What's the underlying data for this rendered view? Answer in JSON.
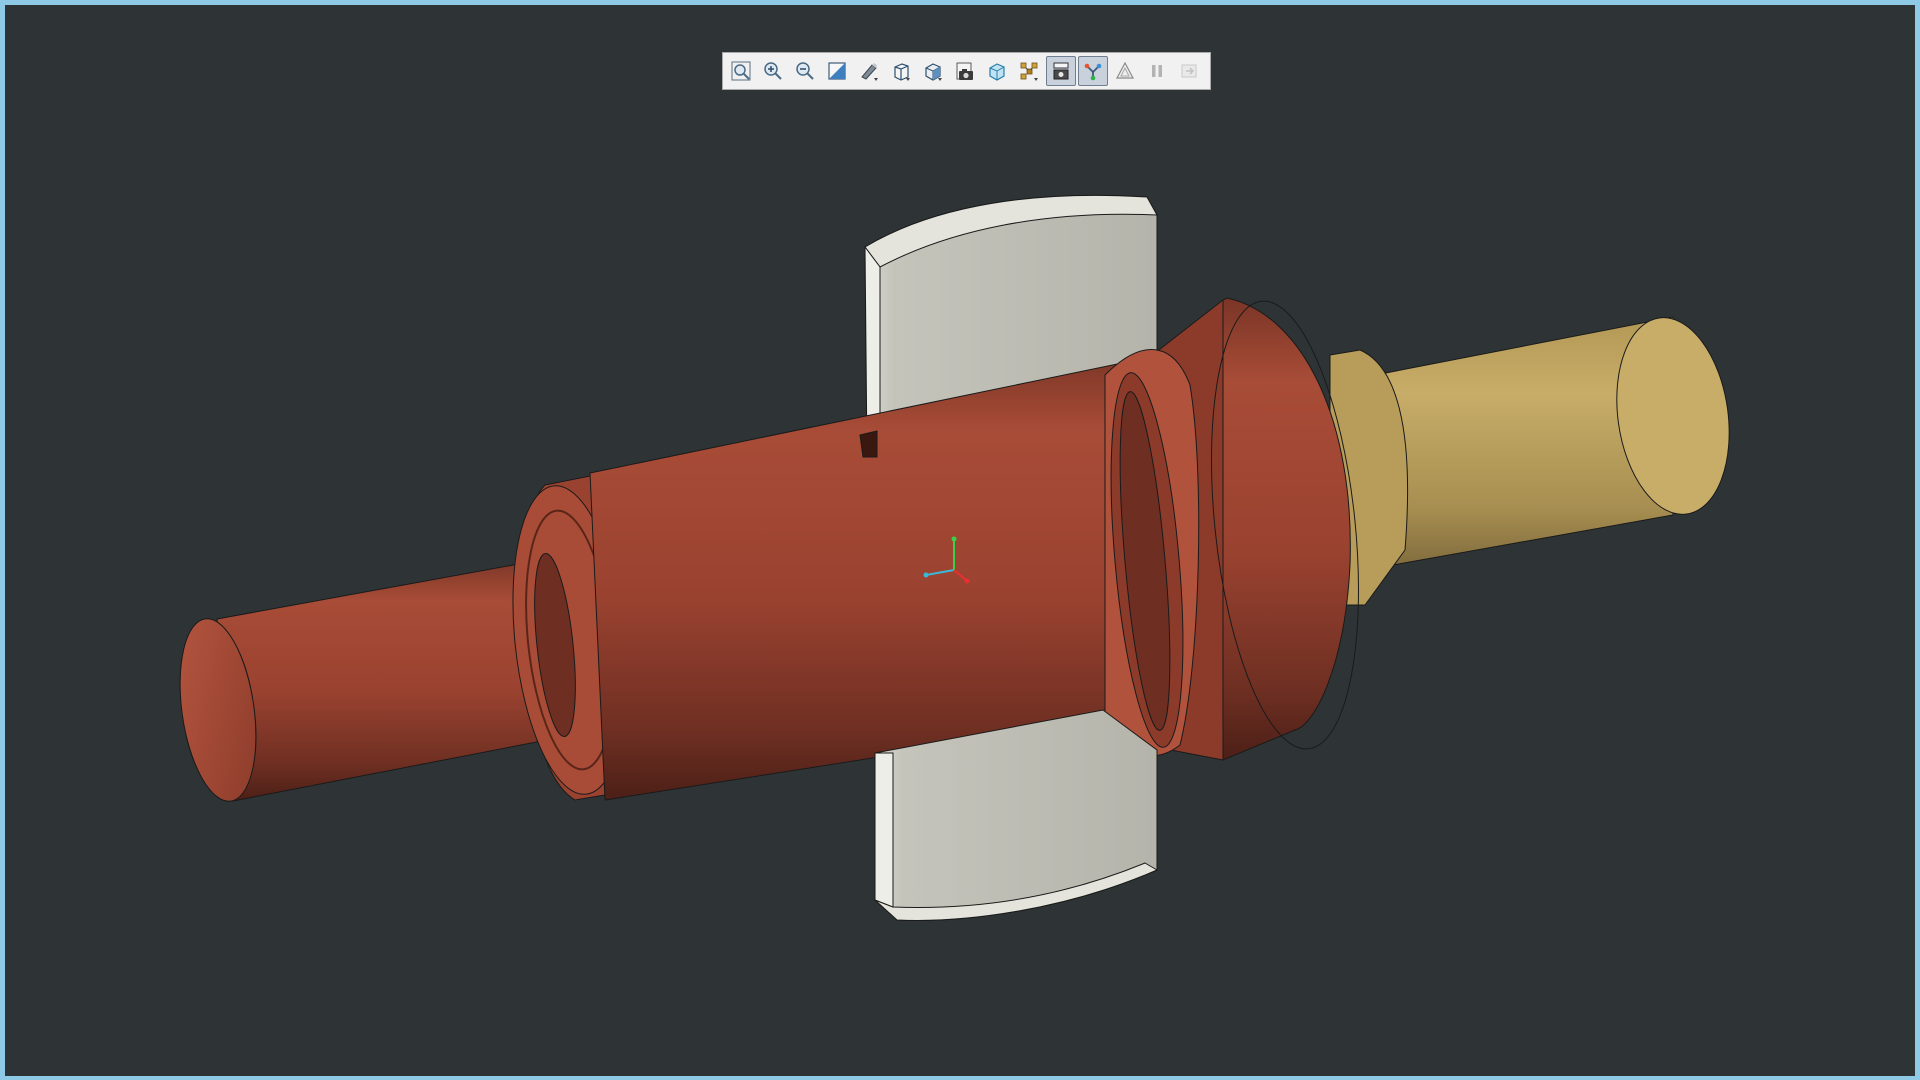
{
  "viewer": {
    "background_color": "#2e3436",
    "frame_color": "#8ec9e6"
  },
  "toolbar": {
    "buttons": [
      {
        "name": "fit-all",
        "icon": "zoom-fit-icon",
        "active": false,
        "disabled": false
      },
      {
        "name": "zoom-in",
        "icon": "zoom-in-icon",
        "active": false,
        "disabled": false
      },
      {
        "name": "zoom-out",
        "icon": "zoom-out-icon",
        "active": false,
        "disabled": false
      },
      {
        "name": "section-view",
        "icon": "section-plane-icon",
        "active": false,
        "disabled": false
      },
      {
        "name": "display-mode",
        "icon": "display-mode-icon",
        "active": false,
        "disabled": false
      },
      {
        "name": "view-orientation",
        "icon": "view-cube-icon",
        "active": false,
        "disabled": false
      },
      {
        "name": "projection",
        "icon": "projection-icon",
        "active": false,
        "disabled": false
      },
      {
        "name": "screenshot",
        "icon": "camera-icon",
        "active": false,
        "disabled": false
      },
      {
        "name": "transparency",
        "icon": "transparent-box-icon",
        "active": false,
        "disabled": false
      },
      {
        "name": "explode",
        "icon": "explode-icon",
        "active": false,
        "disabled": false
      },
      {
        "name": "model-tree",
        "icon": "model-tree-icon",
        "active": true,
        "disabled": false
      },
      {
        "name": "measure",
        "icon": "measure-icon",
        "active": true,
        "disabled": false
      },
      {
        "name": "markup",
        "icon": "markup-triangle-icon",
        "active": false,
        "disabled": false
      },
      {
        "name": "pause",
        "icon": "pause-icon",
        "active": false,
        "disabled": true
      },
      {
        "name": "exit",
        "icon": "exit-icon",
        "active": false,
        "disabled": true
      }
    ]
  },
  "model": {
    "parts": [
      {
        "name": "stepped-shaft",
        "color": "#a84c37"
      },
      {
        "name": "bearing-sleeve",
        "color": "#c7ad68"
      },
      {
        "name": "key-plate",
        "color": "#c1c1b8"
      }
    ],
    "triad_colors": {
      "x": "#e83030",
      "y": "#38d24a",
      "z": "#3ab8d8"
    }
  }
}
